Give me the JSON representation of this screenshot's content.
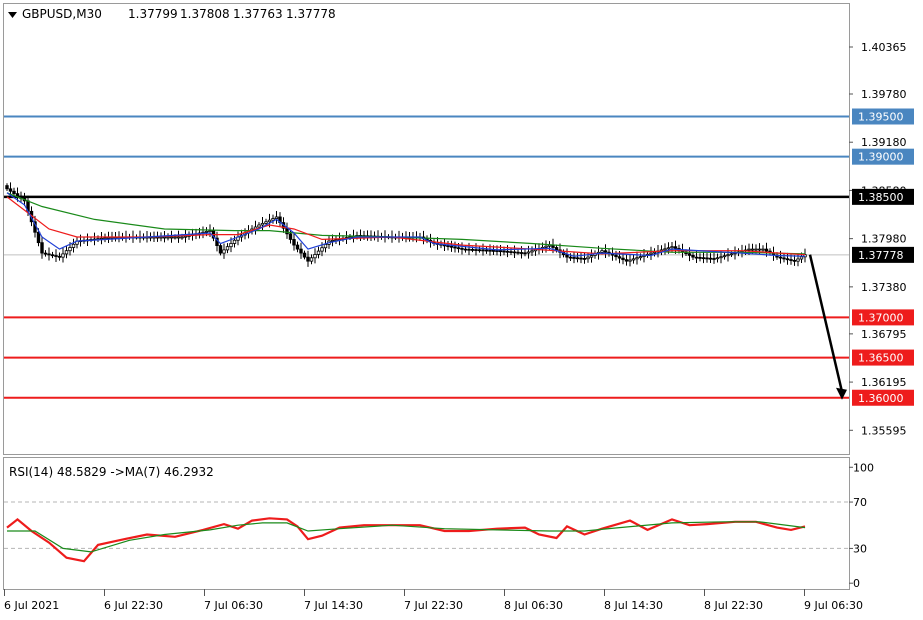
{
  "chart_data": [
    {
      "type": "candlestick",
      "header": {
        "symbol": "GBPUSD,M30",
        "ohlc": [
          "1.37799",
          "1.37808",
          "1.37763",
          "1.37778"
        ]
      },
      "y_ticks": [
        "1.40365",
        "1.39780",
        "1.39180",
        "1.38580",
        "1.37980",
        "1.37380",
        "1.36795",
        "1.36195",
        "1.35595"
      ],
      "ylim": [
        1.353,
        1.409
      ],
      "x_ticks": [
        "6 Jul 2021",
        "6 Jul 22:30",
        "7 Jul 06:30",
        "7 Jul 14:30",
        "7 Jul 22:30",
        "8 Jul 06:30",
        "8 Jul 14:30",
        "8 Jul 22:30",
        "9 Jul 06:30"
      ],
      "current_price": {
        "label": "1.37778",
        "value": 1.37778,
        "color": "#000000"
      },
      "levels": [
        {
          "label": "1.39500",
          "value": 1.395,
          "color": "#4a86c0"
        },
        {
          "label": "1.39000",
          "value": 1.39,
          "color": "#4a86c0"
        },
        {
          "label": "1.38500",
          "value": 1.385,
          "color": "#000000"
        },
        {
          "label": "1.37000",
          "value": 1.37,
          "color": "#ee1c1c"
        },
        {
          "label": "1.36500",
          "value": 1.365,
          "color": "#ee1c1c"
        },
        {
          "label": "1.36000",
          "value": 1.36,
          "color": "#ee1c1c"
        }
      ],
      "forecast_arrow": {
        "from": 1.3778,
        "to": 1.36,
        "color": "#000000"
      },
      "series_colors": {
        "ma_fast": "#1f3fd6",
        "ma_mid": "#ee1c1c",
        "ma_slow": "#1a8a1a"
      },
      "price_path": [
        [
          0,
          1.386
        ],
        [
          5,
          1.3845
        ],
        [
          10,
          1.378
        ],
        [
          15,
          1.3775
        ],
        [
          20,
          1.3795
        ],
        [
          30,
          1.38
        ],
        [
          40,
          1.38
        ],
        [
          50,
          1.38
        ],
        [
          58,
          1.3808
        ],
        [
          61,
          1.378
        ],
        [
          66,
          1.38
        ],
        [
          72,
          1.3815
        ],
        [
          77,
          1.3825
        ],
        [
          82,
          1.379
        ],
        [
          86,
          1.377
        ],
        [
          92,
          1.3795
        ],
        [
          100,
          1.3802
        ],
        [
          110,
          1.38
        ],
        [
          118,
          1.38
        ],
        [
          122,
          1.3792
        ],
        [
          130,
          1.3785
        ],
        [
          140,
          1.3783
        ],
        [
          148,
          1.378
        ],
        [
          155,
          1.379
        ],
        [
          160,
          1.3775
        ],
        [
          165,
          1.3773
        ],
        [
          170,
          1.3783
        ],
        [
          177,
          1.377
        ],
        [
          184,
          1.378
        ],
        [
          190,
          1.3788
        ],
        [
          196,
          1.3775
        ],
        [
          202,
          1.3773
        ],
        [
          206,
          1.3778
        ],
        [
          212,
          1.3785
        ],
        [
          216,
          1.3785
        ],
        [
          220,
          1.3775
        ],
        [
          225,
          1.377
        ],
        [
          228,
          1.3778
        ]
      ],
      "ma_slow_path": [
        [
          0,
          1.3855
        ],
        [
          10,
          1.3838
        ],
        [
          25,
          1.3822
        ],
        [
          45,
          1.381
        ],
        [
          65,
          1.3808
        ],
        [
          75,
          1.3808
        ],
        [
          90,
          1.3802
        ],
        [
          110,
          1.38
        ],
        [
          130,
          1.3797
        ],
        [
          150,
          1.3792
        ],
        [
          170,
          1.3786
        ],
        [
          190,
          1.3781
        ],
        [
          210,
          1.3781
        ],
        [
          228,
          1.3779
        ]
      ],
      "ma_mid_path": [
        [
          0,
          1.385
        ],
        [
          6,
          1.383
        ],
        [
          12,
          1.381
        ],
        [
          20,
          1.38
        ],
        [
          40,
          1.38
        ],
        [
          58,
          1.3803
        ],
        [
          66,
          1.3803
        ],
        [
          75,
          1.3815
        ],
        [
          82,
          1.381
        ],
        [
          90,
          1.3797
        ],
        [
          110,
          1.38
        ],
        [
          130,
          1.379
        ],
        [
          150,
          1.3785
        ],
        [
          170,
          1.3779
        ],
        [
          190,
          1.3783
        ],
        [
          210,
          1.3783
        ],
        [
          228,
          1.3778
        ]
      ],
      "ma_fast_path": [
        [
          0,
          1.3855
        ],
        [
          5,
          1.384
        ],
        [
          10,
          1.38
        ],
        [
          15,
          1.3785
        ],
        [
          20,
          1.3795
        ],
        [
          40,
          1.38
        ],
        [
          58,
          1.3805
        ],
        [
          61,
          1.3792
        ],
        [
          66,
          1.38
        ],
        [
          72,
          1.381
        ],
        [
          77,
          1.3822
        ],
        [
          82,
          1.3805
        ],
        [
          86,
          1.3785
        ],
        [
          92,
          1.3793
        ],
        [
          100,
          1.38
        ],
        [
          118,
          1.38
        ],
        [
          122,
          1.3792
        ],
        [
          140,
          1.3784
        ],
        [
          155,
          1.3786
        ],
        [
          162,
          1.3776
        ],
        [
          170,
          1.378
        ],
        [
          184,
          1.3777
        ],
        [
          190,
          1.3785
        ],
        [
          210,
          1.378
        ],
        [
          220,
          1.3777
        ],
        [
          228,
          1.3776
        ]
      ]
    },
    {
      "type": "line",
      "title": "RSI(14) 48.5829  ->MA(7) 46.2932",
      "y_ticks": [
        "100",
        "70",
        "30",
        "0"
      ],
      "ylim": [
        -5,
        108
      ],
      "levels": [
        70,
        30
      ],
      "series": [
        {
          "name": "RSI(14)",
          "color": "#ee1c1c",
          "points": [
            [
              0,
              48
            ],
            [
              3,
              55
            ],
            [
              7,
              45
            ],
            [
              12,
              35
            ],
            [
              17,
              22
            ],
            [
              22,
              19
            ],
            [
              26,
              33
            ],
            [
              32,
              37
            ],
            [
              40,
              42
            ],
            [
              48,
              40
            ],
            [
              56,
              46
            ],
            [
              62,
              51
            ],
            [
              66,
              47
            ],
            [
              70,
              54
            ],
            [
              75,
              56
            ],
            [
              80,
              55
            ],
            [
              83,
              49
            ],
            [
              86,
              38
            ],
            [
              90,
              41
            ],
            [
              95,
              48
            ],
            [
              102,
              50
            ],
            [
              110,
              50
            ],
            [
              118,
              50
            ],
            [
              125,
              45
            ],
            [
              132,
              45
            ],
            [
              140,
              47
            ],
            [
              148,
              48
            ],
            [
              152,
              42
            ],
            [
              157,
              39
            ],
            [
              160,
              49
            ],
            [
              165,
              42
            ],
            [
              170,
              47
            ],
            [
              178,
              54
            ],
            [
              183,
              46
            ],
            [
              190,
              55
            ],
            [
              195,
              50
            ],
            [
              200,
              51
            ],
            [
              208,
              53
            ],
            [
              214,
              53
            ],
            [
              220,
              48
            ],
            [
              224,
              46
            ],
            [
              228,
              49
            ]
          ]
        },
        {
          "name": "MA(7)",
          "color": "#1a8a1a",
          "points": [
            [
              0,
              45
            ],
            [
              8,
              45
            ],
            [
              16,
              30
            ],
            [
              24,
              27
            ],
            [
              35,
              37
            ],
            [
              45,
              42
            ],
            [
              58,
              46
            ],
            [
              66,
              50
            ],
            [
              73,
              52
            ],
            [
              80,
              52
            ],
            [
              86,
              45
            ],
            [
              95,
              47
            ],
            [
              110,
              50
            ],
            [
              125,
              47
            ],
            [
              140,
              46
            ],
            [
              155,
              45
            ],
            [
              165,
              45
            ],
            [
              175,
              48
            ],
            [
              190,
              52
            ],
            [
              205,
              53
            ],
            [
              215,
              53
            ],
            [
              228,
              48
            ]
          ]
        }
      ]
    }
  ]
}
